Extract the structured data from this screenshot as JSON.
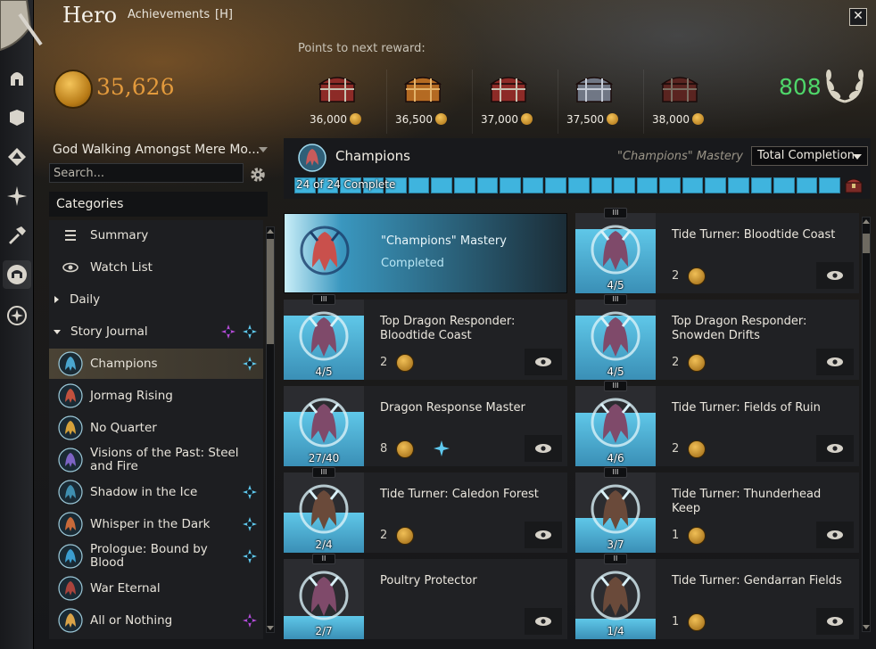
{
  "header": {
    "title": "Hero",
    "tab": "Achievements",
    "hotkey": "[H]",
    "close": "✕"
  },
  "points_label": "Points to next reward:",
  "achievement_points": "35,626",
  "mastery_points": "808",
  "rewards": [
    {
      "cost": "36,000",
      "chest": "red"
    },
    {
      "cost": "36,500",
      "chest": "gold"
    },
    {
      "cost": "37,000",
      "chest": "red"
    },
    {
      "cost": "37,500",
      "chest": "silver"
    },
    {
      "cost": "38,000",
      "chest": "dim-red"
    }
  ],
  "sidebar": {
    "title_select": "God Walking Amongst Mere Mo...",
    "search_placeholder": "Search...",
    "categories_header": "Categories",
    "items": [
      {
        "label": "Summary",
        "icon": "menu-lines-icon",
        "kind": "plain"
      },
      {
        "label": "Watch List",
        "icon": "eye-icon",
        "kind": "plain"
      },
      {
        "label": "Daily",
        "icon": "arrow-right-icon",
        "kind": "group"
      },
      {
        "label": "Story Journal",
        "icon": "arrow-down-icon",
        "kind": "group"
      },
      {
        "label": "Champions",
        "icon": "champion-dragon-icon",
        "kind": "story",
        "selected": true
      },
      {
        "label": "Jormag Rising",
        "icon": "jormag-icon",
        "kind": "story"
      },
      {
        "label": "No Quarter",
        "icon": "compass-icon",
        "kind": "story"
      },
      {
        "label": "Visions of the Past: Steel and Fire",
        "icon": "visions-icon",
        "kind": "story"
      },
      {
        "label": "Shadow in the Ice",
        "icon": "shadow-icon",
        "kind": "story"
      },
      {
        "label": "Whisper in the Dark",
        "icon": "whisper-icon",
        "kind": "story"
      },
      {
        "label": "Prologue: Bound by Blood",
        "icon": "prologue-icon",
        "kind": "story"
      },
      {
        "label": "War Eternal",
        "icon": "war-eternal-icon",
        "kind": "story"
      },
      {
        "label": "All or Nothing",
        "icon": "all-or-nothing-icon",
        "kind": "story"
      }
    ]
  },
  "detail": {
    "title": "Champions",
    "mastery": "\"Champions\" Mastery",
    "filter": "Total Completion",
    "progress_text": "24 of 24 Complete",
    "progress": {
      "done": 24,
      "total": 24
    }
  },
  "cards": [
    {
      "name": "\"Champions\" Mastery",
      "status": "Completed",
      "done": true
    },
    {
      "name": "Tide Turner: Bloodtide Coast",
      "count": "4/5",
      "fill": 0.8,
      "points": "2",
      "tier": "III"
    },
    {
      "name": "Top Dragon Responder: Bloodtide Coast",
      "count": "4/5",
      "fill": 0.8,
      "points": "2",
      "tier": "III"
    },
    {
      "name": "Top Dragon Responder: Snowden Drifts",
      "count": "4/5",
      "fill": 0.8,
      "points": "2",
      "tier": "III"
    },
    {
      "name": "Dragon Response Master",
      "count": "27/40",
      "fill": 0.675,
      "points": "8",
      "tier": "",
      "mastery": true
    },
    {
      "name": "Tide Turner: Fields of Ruin",
      "count": "4/6",
      "fill": 0.667,
      "points": "2",
      "tier": "III"
    },
    {
      "name": "Tide Turner: Caledon Forest",
      "count": "2/4",
      "fill": 0.5,
      "points": "2",
      "tier": "III"
    },
    {
      "name": "Tide Turner: Thunderhead Keep",
      "count": "3/7",
      "fill": 0.43,
      "points": "1",
      "tier": "III"
    },
    {
      "name": "Poultry Protector",
      "count": "2/7",
      "fill": 0.29,
      "points": "",
      "tier": "II"
    },
    {
      "name": "Tide Turner: Gendarran Fields",
      "count": "1/4",
      "fill": 0.25,
      "points": "1",
      "tier": "II"
    }
  ]
}
